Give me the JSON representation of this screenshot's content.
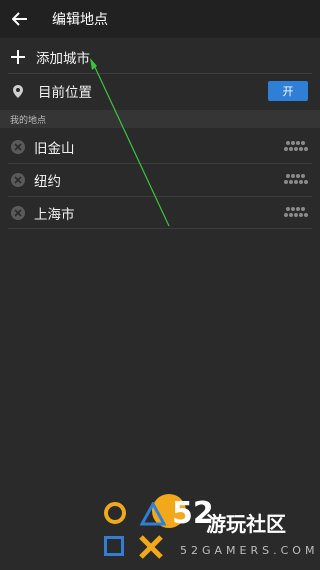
{
  "appbar": {
    "title": "编辑地点",
    "back_icon": "arrow-left-icon"
  },
  "add_city": {
    "label": "添加城市",
    "icon": "plus-icon"
  },
  "current_location": {
    "label": "目前位置",
    "icon": "location-pin-icon",
    "toggle_label": "开",
    "toggle_on": true,
    "toggle_color": "#2f7fd6"
  },
  "section": {
    "title": "我的地点"
  },
  "places": [
    {
      "name": "旧金山"
    },
    {
      "name": "纽约"
    },
    {
      "name": "上海市"
    }
  ],
  "watermark": {
    "number": "52",
    "cn": "游玩社区",
    "en": "52GAMERS.COM",
    "accent": "#f2a81b"
  },
  "colors": {
    "background": "#2a2a2a",
    "appbar": "#212121",
    "annotation_arrow": "#3fc33f"
  }
}
